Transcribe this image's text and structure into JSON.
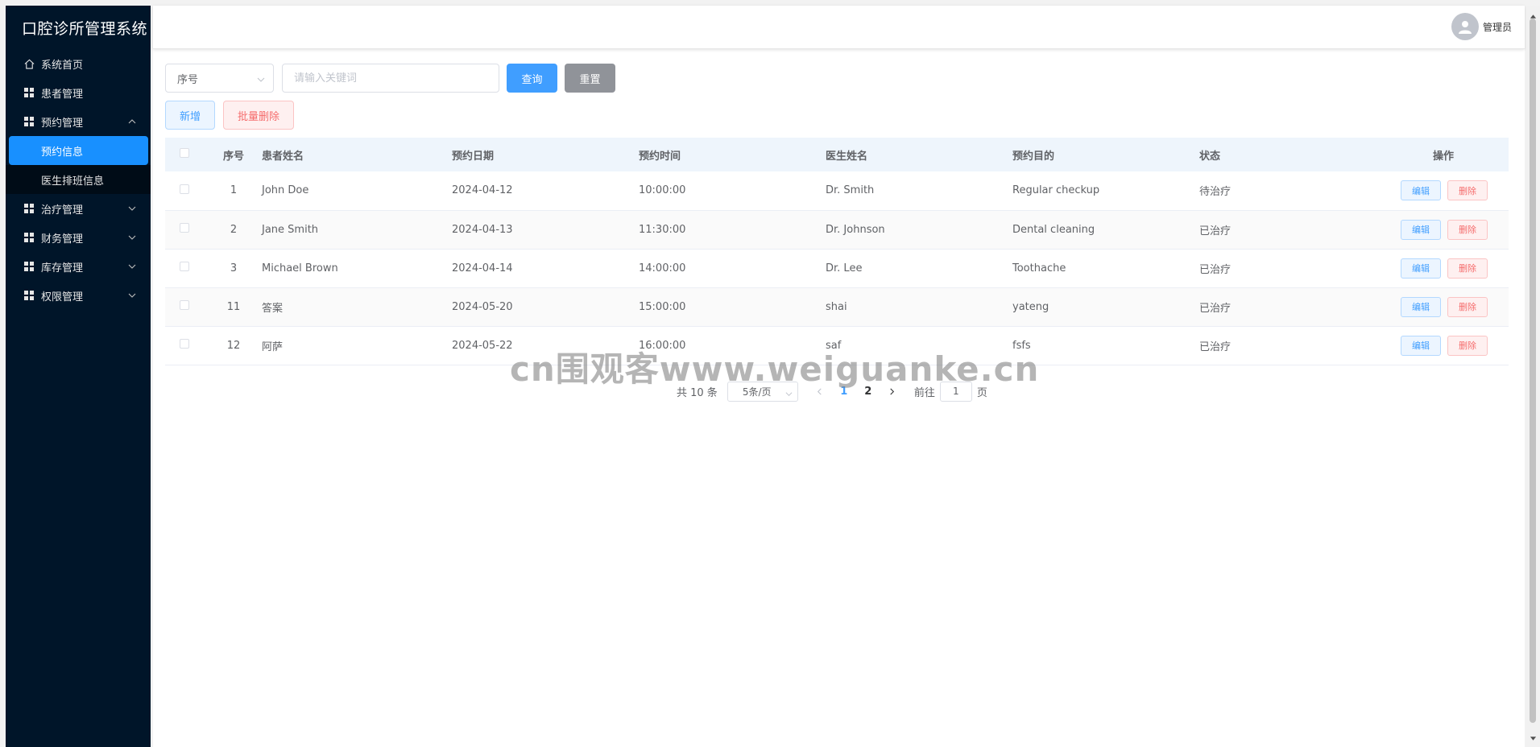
{
  "app": {
    "title": "口腔诊所管理系统"
  },
  "user": {
    "name": "管理员"
  },
  "sidebar": {
    "items": [
      {
        "label": "系统首页",
        "icon": "home-icon"
      },
      {
        "label": "患者管理",
        "icon": "grid-icon"
      },
      {
        "label": "预约管理",
        "icon": "grid-icon",
        "expanded": true,
        "children": [
          {
            "label": "预约信息",
            "active": true
          },
          {
            "label": "医生排班信息"
          }
        ]
      },
      {
        "label": "治疗管理",
        "icon": "grid-icon"
      },
      {
        "label": "财务管理",
        "icon": "grid-icon"
      },
      {
        "label": "库存管理",
        "icon": "grid-icon"
      },
      {
        "label": "权限管理",
        "icon": "grid-icon"
      }
    ]
  },
  "search": {
    "field_select": "序号",
    "placeholder": "请输入关键词",
    "query_label": "查询",
    "reset_label": "重置"
  },
  "actions": {
    "add_label": "新增",
    "batch_delete_label": "批量删除"
  },
  "table": {
    "headers": {
      "no": "序号",
      "patient": "患者姓名",
      "date": "预约日期",
      "time": "预约时间",
      "doctor": "医生姓名",
      "purpose": "预约目的",
      "status": "状态",
      "ops": "操作"
    },
    "edit_label": "编辑",
    "delete_label": "删除",
    "rows": [
      {
        "no": "1",
        "patient": "John Doe",
        "date": "2024-04-12",
        "time": "10:00:00",
        "doctor": "Dr. Smith",
        "purpose": "Regular checkup",
        "status": "待治疗"
      },
      {
        "no": "2",
        "patient": "Jane Smith",
        "date": "2024-04-13",
        "time": "11:30:00",
        "doctor": "Dr. Johnson",
        "purpose": "Dental cleaning",
        "status": "已治疗"
      },
      {
        "no": "3",
        "patient": "Michael Brown",
        "date": "2024-04-14",
        "time": "14:00:00",
        "doctor": "Dr. Lee",
        "purpose": "Toothache",
        "status": "已治疗"
      },
      {
        "no": "11",
        "patient": "答案",
        "date": "2024-05-20",
        "time": "15:00:00",
        "doctor": "shai",
        "purpose": "yateng",
        "status": "已治疗"
      },
      {
        "no": "12",
        "patient": "阿萨",
        "date": "2024-05-22",
        "time": "16:00:00",
        "doctor": "saf",
        "purpose": "fsfs",
        "status": "已治疗"
      }
    ]
  },
  "pagination": {
    "total_text": "共 10 条",
    "page_size": "5条/页",
    "pages": [
      "1",
      "2"
    ],
    "current_page": "1",
    "goto_prefix": "前往",
    "goto_value": "1",
    "goto_suffix": "页"
  },
  "watermark": "cn围观客www.weiguanke.cn",
  "colors": {
    "sidebar_bg": "#001529",
    "primary": "#409eff",
    "active_menu": "#1890ff",
    "danger": "#f56c6c",
    "info": "#909399"
  }
}
